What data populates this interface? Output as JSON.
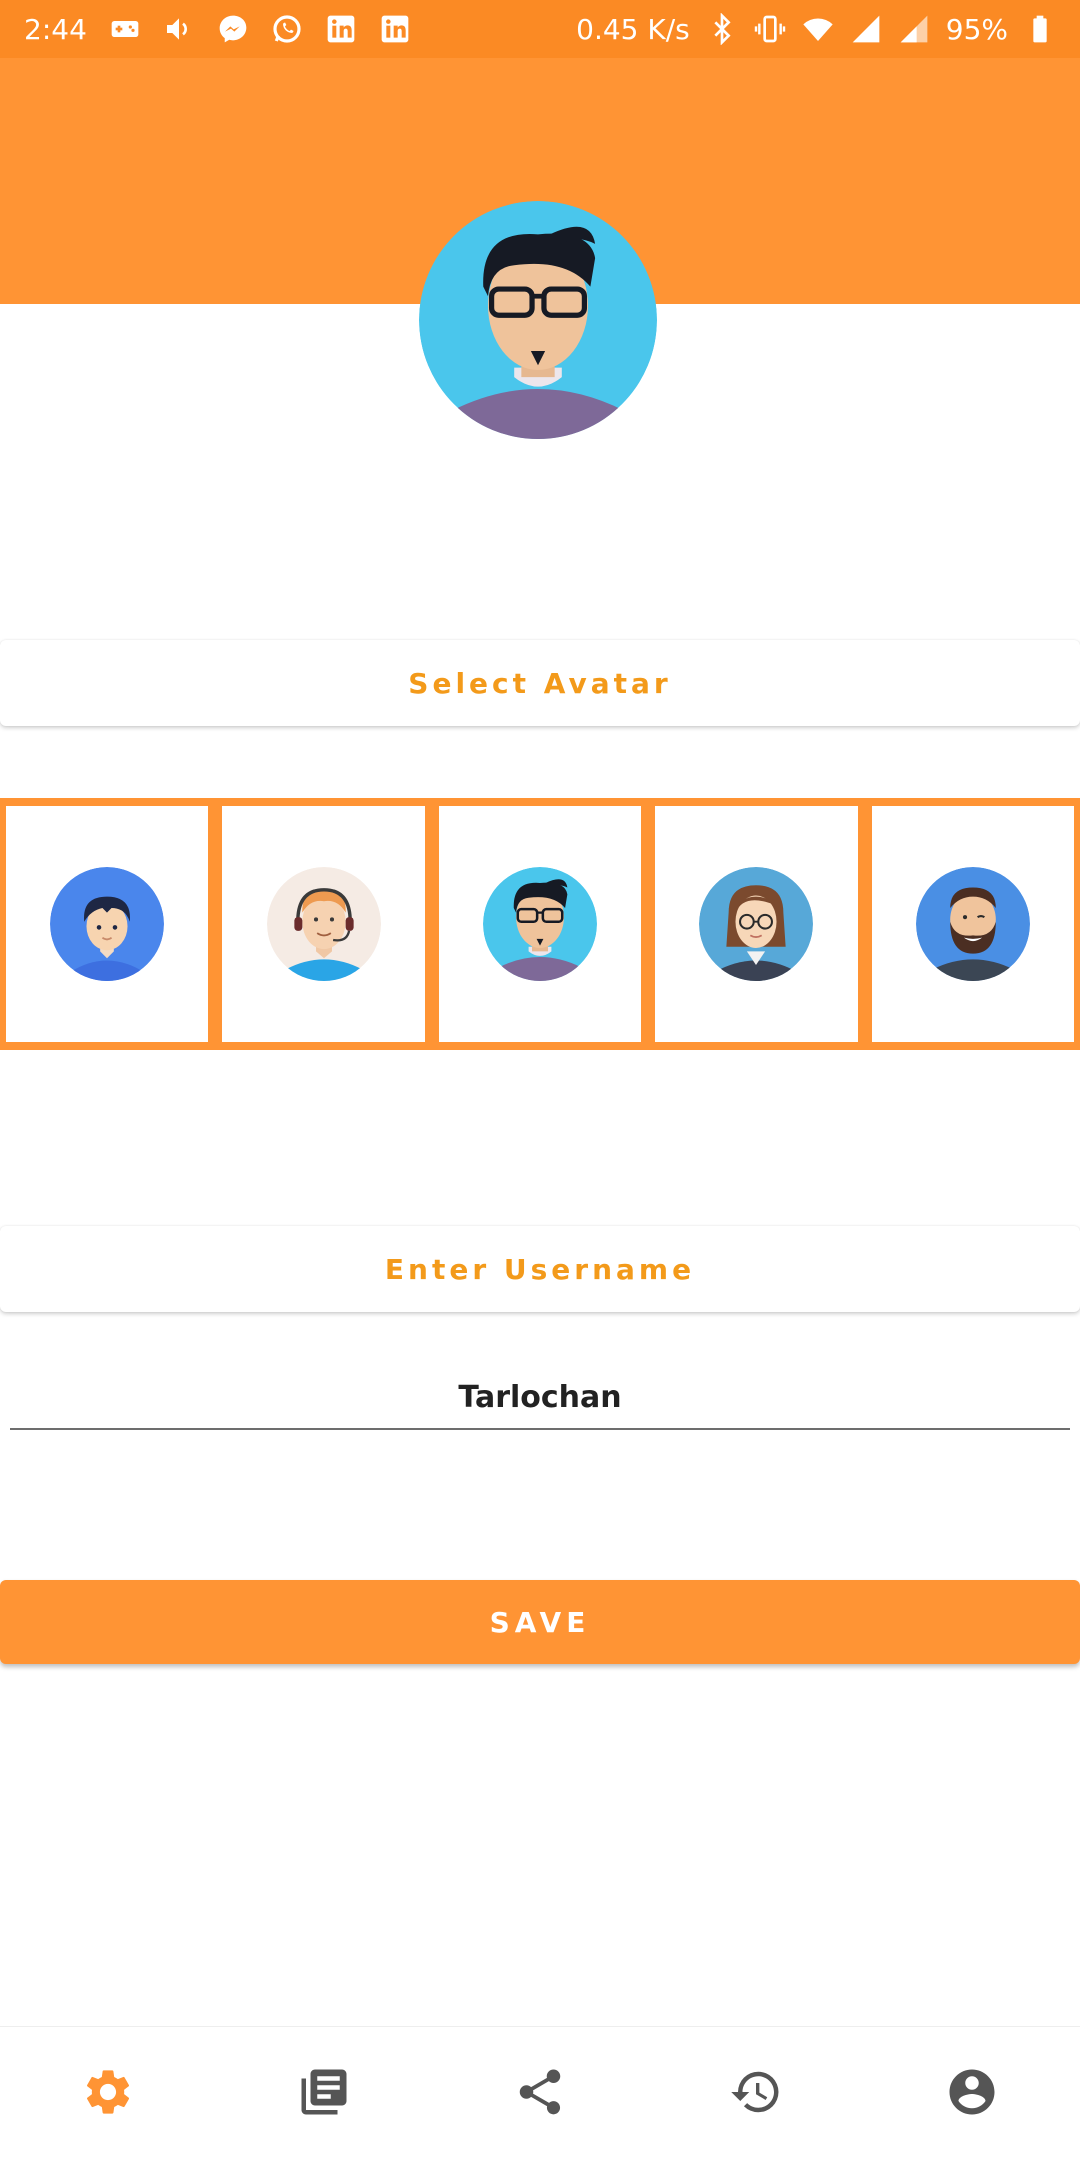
{
  "status_bar": {
    "time": "2:44",
    "network_speed": "0.45 K/s",
    "battery": "95%",
    "left_icons": [
      "gamepad-icon",
      "volume-icon",
      "messenger-icon",
      "whatsapp-icon",
      "linkedin-icon",
      "linkedin-icon"
    ],
    "right_icons": [
      "bluetooth-icon",
      "vibrate-icon",
      "wifi-icon",
      "signal-icon",
      "signal-icon",
      "battery-icon"
    ]
  },
  "profile": {
    "selected_avatar": "avatar-glasses-man"
  },
  "sections": {
    "select_avatar_label": "Select Avatar",
    "enter_username_label": "Enter Username"
  },
  "avatars": [
    {
      "name": "avatar-boy"
    },
    {
      "name": "avatar-headset-man"
    },
    {
      "name": "avatar-glasses-man"
    },
    {
      "name": "avatar-woman-glasses"
    },
    {
      "name": "avatar-bearded-man"
    }
  ],
  "username": {
    "value": "Tarlochan"
  },
  "save_label": "SAVE",
  "bottom_nav": [
    {
      "icon": "settings-icon",
      "active": true
    },
    {
      "icon": "articles-icon",
      "active": false
    },
    {
      "icon": "share-icon",
      "active": false
    },
    {
      "icon": "history-icon",
      "active": false
    },
    {
      "icon": "account-icon",
      "active": false
    }
  ],
  "colors": {
    "accent": "#ff9434",
    "label_text": "#f39a1a",
    "nav_inactive": "#555555"
  }
}
